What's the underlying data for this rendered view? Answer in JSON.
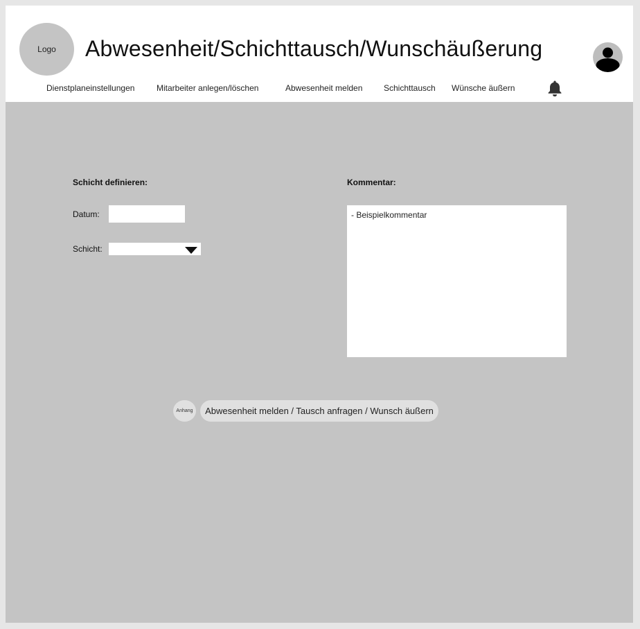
{
  "header": {
    "logo_label": "Logo",
    "title": "Abwesenheit/Schichttausch/Wunschäußerung"
  },
  "nav": {
    "items": [
      {
        "label": "Dienstplaneinstellungen"
      },
      {
        "label": "Mitarbeiter anlegen/löschen"
      },
      {
        "label": "Abwesenheit melden"
      },
      {
        "label": "Schichttausch"
      },
      {
        "label": "Wünsche äußern"
      }
    ]
  },
  "icons": {
    "bell": "bell-icon",
    "user": "user-icon",
    "dropdown": "triangle-down-icon"
  },
  "form": {
    "shift_section_label": "Schicht definieren:",
    "date_label": "Datum:",
    "date_value": "",
    "shift_label": "Schicht:",
    "shift_value": "",
    "comment_label": "Kommentar:",
    "comment_value": "- Beispielkommentar"
  },
  "actions": {
    "attach_label": "Anhang",
    "submit_label": "Abwesenheit melden / Tausch anfragen / Wunsch äußern"
  },
  "colors": {
    "background": "#c4c4c4",
    "header": "#ffffff",
    "button": "#e0e0e0"
  }
}
